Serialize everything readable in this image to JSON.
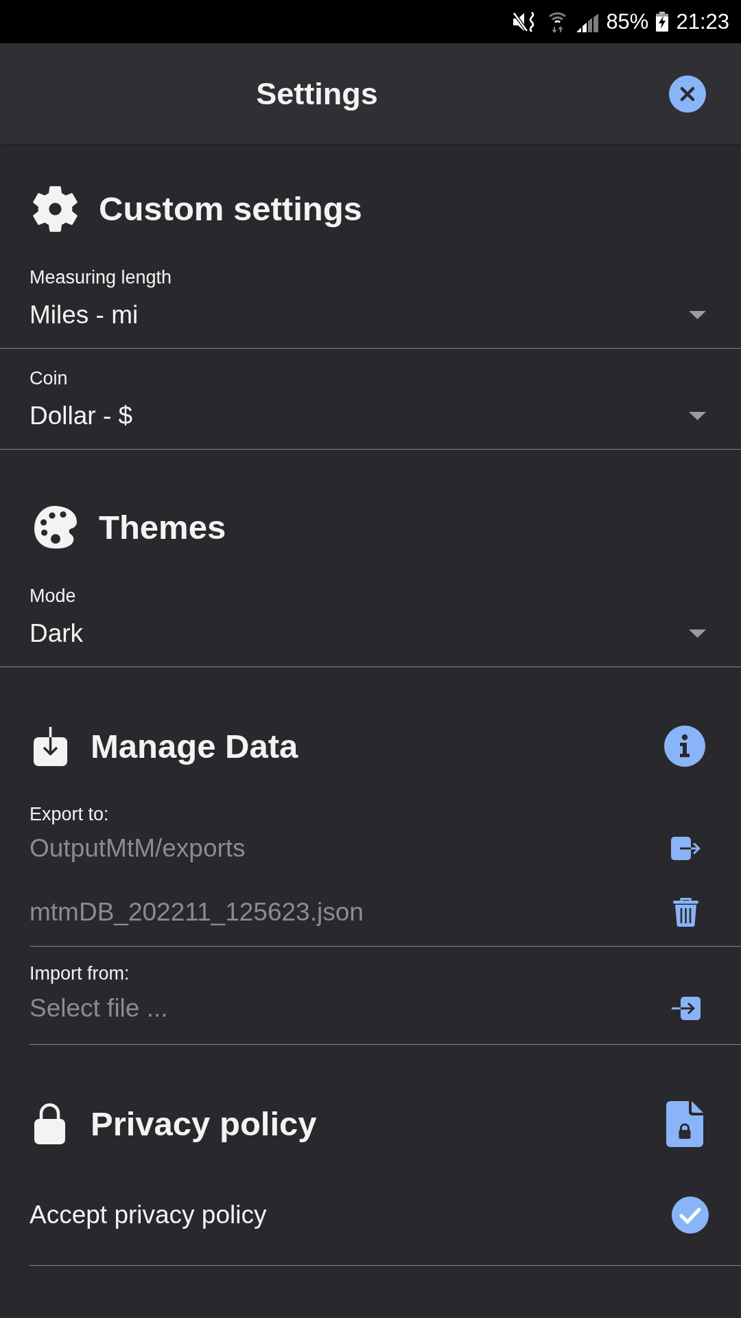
{
  "status_bar": {
    "battery": "85%",
    "time": "21:23"
  },
  "header": {
    "title": "Settings"
  },
  "custom_settings": {
    "heading": "Custom settings",
    "fields": [
      {
        "label": "Measuring length",
        "value": "Miles - mi"
      },
      {
        "label": "Coin",
        "value": "Dollar - $"
      }
    ]
  },
  "themes": {
    "heading": "Themes",
    "fields": [
      {
        "label": "Mode",
        "value": "Dark"
      }
    ]
  },
  "manage_data": {
    "heading": "Manage Data",
    "export": {
      "label": "Export to:",
      "folder": "OutputMtM/exports",
      "file": "mtmDB_202211_125623.json"
    },
    "import": {
      "label": "Import from:",
      "placeholder": "Select file ..."
    }
  },
  "privacy_policy": {
    "heading": "Privacy policy",
    "accept": {
      "label": "Accept privacy policy",
      "checked": true
    }
  }
}
